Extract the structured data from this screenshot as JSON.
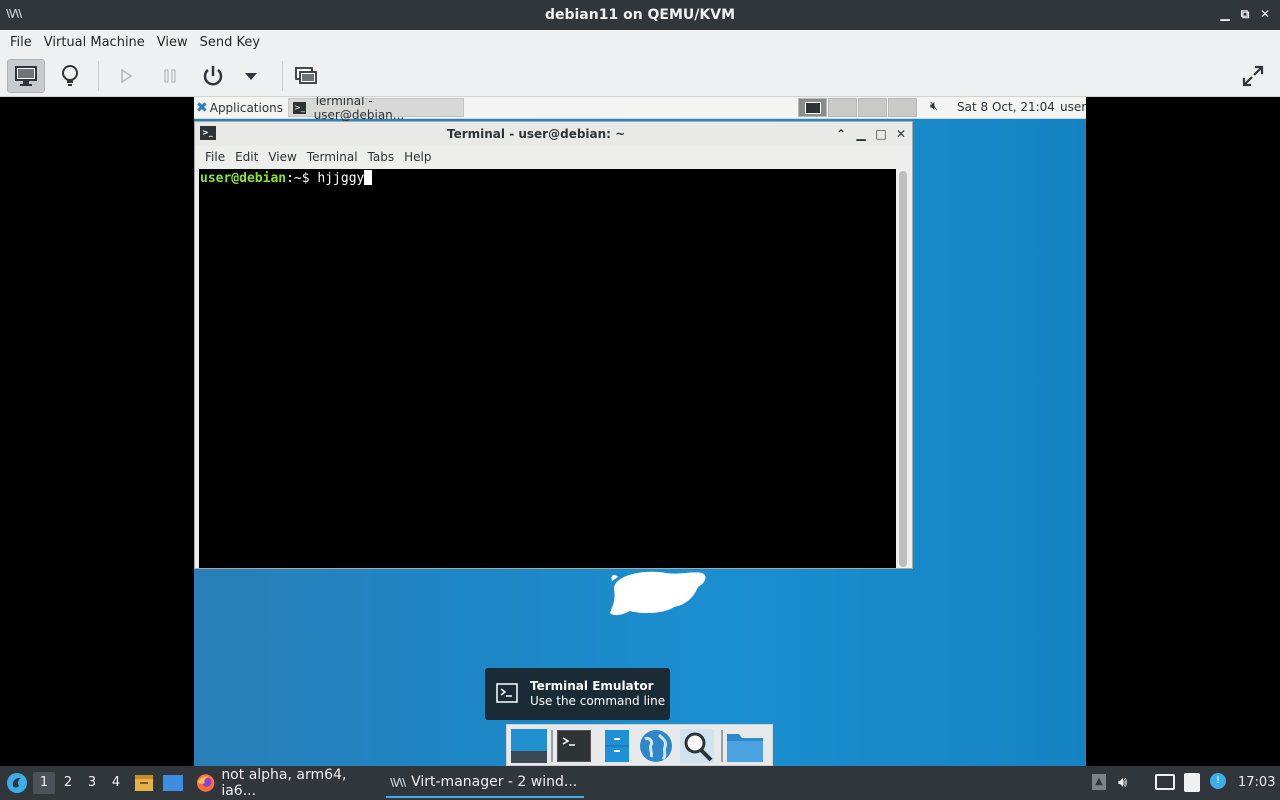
{
  "host": {
    "title": "debian11 on QEMU/KVM",
    "menu": [
      "File",
      "Virtual Machine",
      "View",
      "Send Key"
    ],
    "toolbar": {
      "icons": [
        "console-icon",
        "lightbulb-icon",
        "play-icon",
        "pause-icon",
        "power-icon",
        "dropdown-icon",
        "snapshot-icon",
        "fullscreen-icon"
      ],
      "active": "console-icon"
    }
  },
  "guest": {
    "panel": {
      "applications_label": "Applications :",
      "task_label": "Terminal - user@debian...",
      "date_time": "Sat  8 Oct, 21:04",
      "user": "user"
    },
    "terminal": {
      "title": "Terminal - user@debian: ~",
      "menu": [
        "File",
        "Edit",
        "View",
        "Terminal",
        "Tabs",
        "Help"
      ],
      "prompt_user_host": "user@debian",
      "prompt_path": ":~$",
      "command": "hjjggy"
    },
    "tooltip": {
      "title": "Terminal Emulator",
      "subtitle": "Use the command line"
    }
  },
  "host_taskbar": {
    "workspaces": [
      "1",
      "2",
      "3",
      "4"
    ],
    "active_workspace": "1",
    "tasks": [
      {
        "label": "not alpha, arm64, ia6...",
        "icon": "firefox-icon"
      },
      {
        "label": "Virt-manager - 2 wind...",
        "icon": "virt-manager-icon"
      }
    ],
    "clock": "17:03"
  },
  "colors": {
    "host_chrome": "#31363b",
    "guest_desktop": "#1a8fd0",
    "prompt_green": "#8ae234",
    "accent": "#3daee9"
  }
}
